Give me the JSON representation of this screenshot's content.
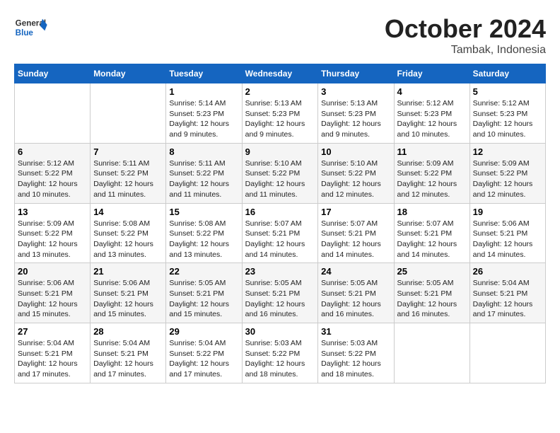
{
  "logo": {
    "general": "General",
    "blue": "Blue"
  },
  "header": {
    "month": "October 2024",
    "location": "Tambak, Indonesia"
  },
  "days_of_week": [
    "Sunday",
    "Monday",
    "Tuesday",
    "Wednesday",
    "Thursday",
    "Friday",
    "Saturday"
  ],
  "weeks": [
    [
      {
        "day": "",
        "content": ""
      },
      {
        "day": "",
        "content": ""
      },
      {
        "day": "1",
        "content": "Sunrise: 5:14 AM\nSunset: 5:23 PM\nDaylight: 12 hours and 9 minutes."
      },
      {
        "day": "2",
        "content": "Sunrise: 5:13 AM\nSunset: 5:23 PM\nDaylight: 12 hours and 9 minutes."
      },
      {
        "day": "3",
        "content": "Sunrise: 5:13 AM\nSunset: 5:23 PM\nDaylight: 12 hours and 9 minutes."
      },
      {
        "day": "4",
        "content": "Sunrise: 5:12 AM\nSunset: 5:23 PM\nDaylight: 12 hours and 10 minutes."
      },
      {
        "day": "5",
        "content": "Sunrise: 5:12 AM\nSunset: 5:23 PM\nDaylight: 12 hours and 10 minutes."
      }
    ],
    [
      {
        "day": "6",
        "content": "Sunrise: 5:12 AM\nSunset: 5:22 PM\nDaylight: 12 hours and 10 minutes."
      },
      {
        "day": "7",
        "content": "Sunrise: 5:11 AM\nSunset: 5:22 PM\nDaylight: 12 hours and 11 minutes."
      },
      {
        "day": "8",
        "content": "Sunrise: 5:11 AM\nSunset: 5:22 PM\nDaylight: 12 hours and 11 minutes."
      },
      {
        "day": "9",
        "content": "Sunrise: 5:10 AM\nSunset: 5:22 PM\nDaylight: 12 hours and 11 minutes."
      },
      {
        "day": "10",
        "content": "Sunrise: 5:10 AM\nSunset: 5:22 PM\nDaylight: 12 hours and 12 minutes."
      },
      {
        "day": "11",
        "content": "Sunrise: 5:09 AM\nSunset: 5:22 PM\nDaylight: 12 hours and 12 minutes."
      },
      {
        "day": "12",
        "content": "Sunrise: 5:09 AM\nSunset: 5:22 PM\nDaylight: 12 hours and 12 minutes."
      }
    ],
    [
      {
        "day": "13",
        "content": "Sunrise: 5:09 AM\nSunset: 5:22 PM\nDaylight: 12 hours and 13 minutes."
      },
      {
        "day": "14",
        "content": "Sunrise: 5:08 AM\nSunset: 5:22 PM\nDaylight: 12 hours and 13 minutes."
      },
      {
        "day": "15",
        "content": "Sunrise: 5:08 AM\nSunset: 5:22 PM\nDaylight: 12 hours and 13 minutes."
      },
      {
        "day": "16",
        "content": "Sunrise: 5:07 AM\nSunset: 5:21 PM\nDaylight: 12 hours and 14 minutes."
      },
      {
        "day": "17",
        "content": "Sunrise: 5:07 AM\nSunset: 5:21 PM\nDaylight: 12 hours and 14 minutes."
      },
      {
        "day": "18",
        "content": "Sunrise: 5:07 AM\nSunset: 5:21 PM\nDaylight: 12 hours and 14 minutes."
      },
      {
        "day": "19",
        "content": "Sunrise: 5:06 AM\nSunset: 5:21 PM\nDaylight: 12 hours and 14 minutes."
      }
    ],
    [
      {
        "day": "20",
        "content": "Sunrise: 5:06 AM\nSunset: 5:21 PM\nDaylight: 12 hours and 15 minutes."
      },
      {
        "day": "21",
        "content": "Sunrise: 5:06 AM\nSunset: 5:21 PM\nDaylight: 12 hours and 15 minutes."
      },
      {
        "day": "22",
        "content": "Sunrise: 5:05 AM\nSunset: 5:21 PM\nDaylight: 12 hours and 15 minutes."
      },
      {
        "day": "23",
        "content": "Sunrise: 5:05 AM\nSunset: 5:21 PM\nDaylight: 12 hours and 16 minutes."
      },
      {
        "day": "24",
        "content": "Sunrise: 5:05 AM\nSunset: 5:21 PM\nDaylight: 12 hours and 16 minutes."
      },
      {
        "day": "25",
        "content": "Sunrise: 5:05 AM\nSunset: 5:21 PM\nDaylight: 12 hours and 16 minutes."
      },
      {
        "day": "26",
        "content": "Sunrise: 5:04 AM\nSunset: 5:21 PM\nDaylight: 12 hours and 17 minutes."
      }
    ],
    [
      {
        "day": "27",
        "content": "Sunrise: 5:04 AM\nSunset: 5:21 PM\nDaylight: 12 hours and 17 minutes."
      },
      {
        "day": "28",
        "content": "Sunrise: 5:04 AM\nSunset: 5:21 PM\nDaylight: 12 hours and 17 minutes."
      },
      {
        "day": "29",
        "content": "Sunrise: 5:04 AM\nSunset: 5:22 PM\nDaylight: 12 hours and 17 minutes."
      },
      {
        "day": "30",
        "content": "Sunrise: 5:03 AM\nSunset: 5:22 PM\nDaylight: 12 hours and 18 minutes."
      },
      {
        "day": "31",
        "content": "Sunrise: 5:03 AM\nSunset: 5:22 PM\nDaylight: 12 hours and 18 minutes."
      },
      {
        "day": "",
        "content": ""
      },
      {
        "day": "",
        "content": ""
      }
    ]
  ]
}
